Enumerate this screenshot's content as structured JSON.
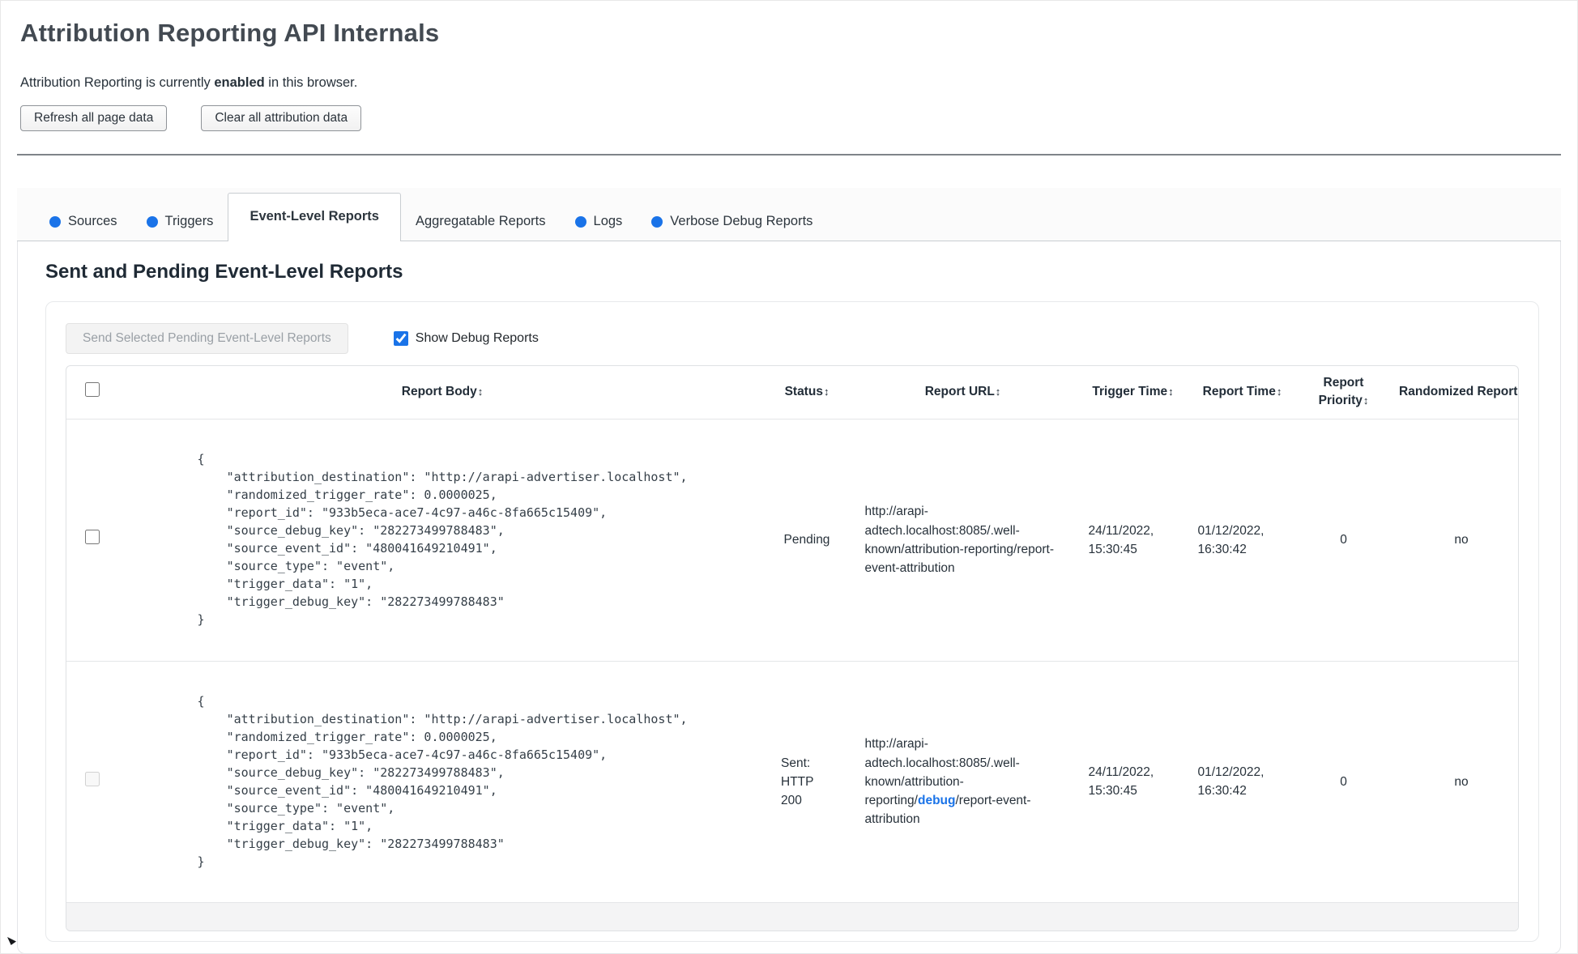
{
  "page": {
    "title": "Attribution Reporting API Internals",
    "status_prefix": "Attribution Reporting is currently ",
    "status_bold": "enabled",
    "status_suffix": " in this browser.",
    "refresh_button": "Refresh all page data",
    "clear_button": "Clear all attribution data"
  },
  "tabs": [
    {
      "label": "Sources",
      "has_dot": true,
      "active": false
    },
    {
      "label": "Triggers",
      "has_dot": true,
      "active": false
    },
    {
      "label": "Event-Level Reports",
      "has_dot": false,
      "active": true
    },
    {
      "label": "Aggregatable Reports",
      "has_dot": false,
      "active": false
    },
    {
      "label": "Logs",
      "has_dot": true,
      "active": false
    },
    {
      "label": "Verbose Debug Reports",
      "has_dot": true,
      "active": false
    }
  ],
  "section": {
    "heading": "Sent and Pending Event-Level Reports",
    "send_button": "Send Selected Pending Event-Level Reports",
    "show_debug_label": "Show Debug Reports",
    "show_debug_checked": true
  },
  "table": {
    "sort_icon": "↕",
    "columns": {
      "report_body": "Report Body",
      "status": "Status",
      "report_url": "Report URL",
      "trigger_time": "Trigger Time",
      "report_time": "Report Time",
      "report_priority": "Report Priority",
      "randomized_report": "Randomized Report"
    },
    "rows": [
      {
        "checkbox_disabled": false,
        "report_body": "{\n    \"attribution_destination\": \"http://arapi-advertiser.localhost\",\n    \"randomized_trigger_rate\": 0.0000025,\n    \"report_id\": \"933b5eca-ace7-4c97-a46c-8fa665c15409\",\n    \"source_debug_key\": \"282273499788483\",\n    \"source_event_id\": \"480041649210491\",\n    \"source_type\": \"event\",\n    \"trigger_data\": \"1\",\n    \"trigger_debug_key\": \"282273499788483\"\n}",
        "status": "Pending",
        "url_prefix": "http://arapi-adtech.localhost:8085/.well-known/attribution-reporting/",
        "url_debug": "",
        "url_suffix": "report-event-attribution",
        "trigger_time": "24/11/2022, 15:30:45",
        "report_time": "01/12/2022, 16:30:42",
        "priority": "0",
        "randomized": "no"
      },
      {
        "checkbox_disabled": true,
        "report_body": "{\n    \"attribution_destination\": \"http://arapi-advertiser.localhost\",\n    \"randomized_trigger_rate\": 0.0000025,\n    \"report_id\": \"933b5eca-ace7-4c97-a46c-8fa665c15409\",\n    \"source_debug_key\": \"282273499788483\",\n    \"source_event_id\": \"480041649210491\",\n    \"source_type\": \"event\",\n    \"trigger_data\": \"1\",\n    \"trigger_debug_key\": \"282273499788483\"\n}",
        "status": "Sent: HTTP 200",
        "url_prefix": "http://arapi-adtech.localhost:8085/.well-known/attribution-reporting/",
        "url_debug": "debug",
        "url_suffix": "/report-event-attribution",
        "trigger_time": "24/11/2022, 15:30:45",
        "report_time": "01/12/2022, 16:30:42",
        "priority": "0",
        "randomized": "no"
      }
    ]
  },
  "colors": {
    "accent_blue": "#1a73e8"
  }
}
